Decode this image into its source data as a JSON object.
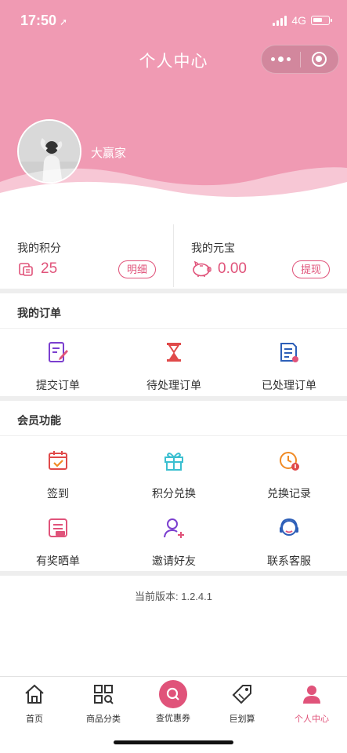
{
  "status": {
    "time": "17:50",
    "network": "4G"
  },
  "header": {
    "title": "个人中心",
    "username": "大赢家"
  },
  "points": {
    "label": "我的积分",
    "value": "25",
    "button": "明细"
  },
  "yuanbao": {
    "label": "我的元宝",
    "value": "0.00",
    "button": "提现"
  },
  "orders": {
    "title": "我的订单",
    "items": [
      {
        "label": "提交订单",
        "icon": "submit-order-icon",
        "color": "#7b3fcf"
      },
      {
        "label": "待处理订单",
        "icon": "hourglass-icon",
        "color": "#e04a4a"
      },
      {
        "label": "已处理订单",
        "icon": "processed-order-icon",
        "color": "#2d5fb8"
      }
    ]
  },
  "member": {
    "title": "会员功能",
    "items": [
      {
        "label": "签到",
        "icon": "calendar-checkin-icon",
        "color": "#e04a4a"
      },
      {
        "label": "积分兑换",
        "icon": "gift-icon",
        "color": "#3bbfd0"
      },
      {
        "label": "兑换记录",
        "icon": "clock-record-icon",
        "color": "#f08a24"
      },
      {
        "label": "有奖晒单",
        "icon": "prize-post-icon",
        "color": "#e0537a"
      },
      {
        "label": "邀请好友",
        "icon": "invite-friend-icon",
        "color": "#7b3fcf"
      },
      {
        "label": "联系客服",
        "icon": "customer-service-icon",
        "color": "#2d5fb8"
      }
    ]
  },
  "version": "当前版本: 1.2.4.1",
  "tabbar": [
    {
      "label": "首页",
      "icon": "home-icon"
    },
    {
      "label": "商品分类",
      "icon": "category-icon"
    },
    {
      "label": "查优惠券",
      "icon": "coupon-search-icon"
    },
    {
      "label": "巨划算",
      "icon": "tag-icon"
    },
    {
      "label": "个人中心",
      "icon": "profile-icon"
    }
  ],
  "colors": {
    "header": "#f09ab3",
    "accent": "#e0537a"
  }
}
